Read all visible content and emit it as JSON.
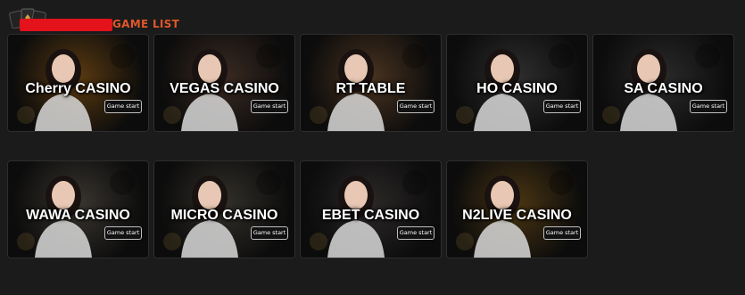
{
  "header": {
    "title": "GAME LIST",
    "logo_icon": "playing-cards-icon",
    "redaction_color": "#e3121b"
  },
  "accent_color": "#e0572a",
  "games": [
    {
      "name": "Cherry CASINO",
      "button": "Game start",
      "theme": "#5a3a10"
    },
    {
      "name": "VEGAS CASINO",
      "button": "Game start",
      "theme": "#3a2a22"
    },
    {
      "name": "RT TABLE",
      "button": "Game start",
      "theme": "#4a3320"
    },
    {
      "name": "HO CASINO",
      "button": "Game start",
      "theme": "#2e2e2e"
    },
    {
      "name": "SA CASINO",
      "button": "Game start",
      "theme": "#2a2a2a"
    },
    {
      "name": "WAWA CASINO",
      "button": "Game start",
      "theme": "#3a3630"
    },
    {
      "name": "MICRO CASINO",
      "button": "Game start",
      "theme": "#33302a"
    },
    {
      "name": "EBET CASINO",
      "button": "Game start",
      "theme": "#2c2828"
    },
    {
      "name": "N2LIVE CASINO",
      "button": "Game start",
      "theme": "#4a3512"
    }
  ]
}
